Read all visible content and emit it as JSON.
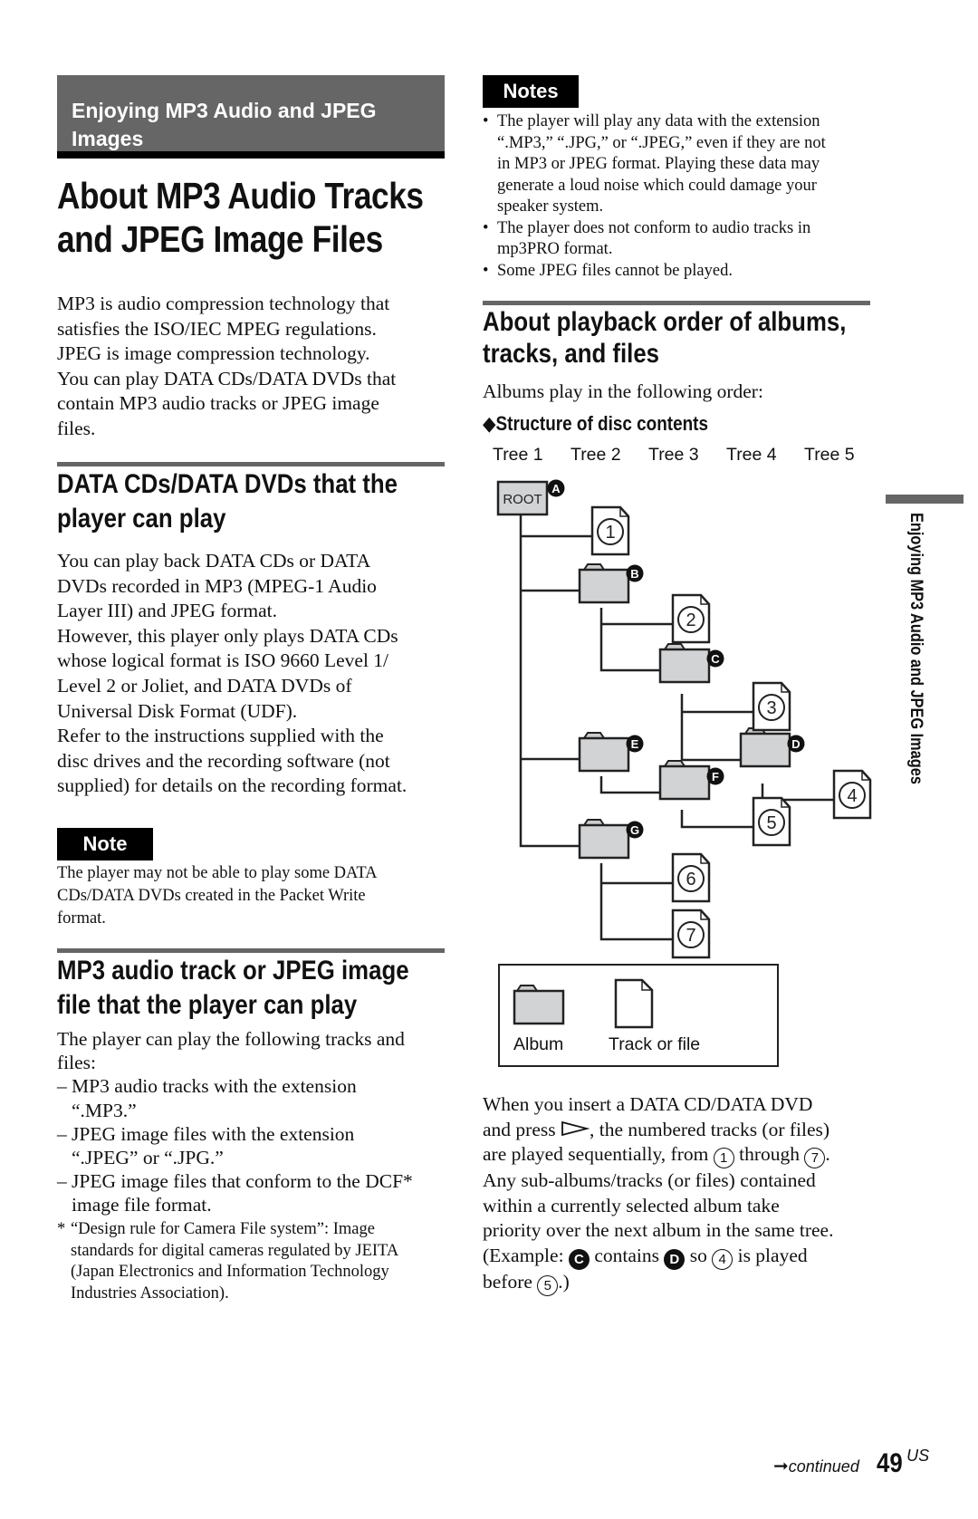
{
  "section_band": {
    "title": "Enjoying MP3 Audio and JPEG Images"
  },
  "main_title": {
    "line1": "About MP3 Audio Tracks",
    "line2": "and JPEG Image Files"
  },
  "intro": {
    "lines": [
      "MP3 is audio compression technology that",
      "satisfies the ISO/IEC MPEG regulations.",
      "JPEG is image compression technology.",
      "You can play DATA CDs/DATA DVDs that",
      "contain MP3 audio tracks or JPEG image",
      "files."
    ]
  },
  "section_discs": {
    "heading_line1": "DATA CDs/DATA DVDs that the",
    "heading_line2": "player can play",
    "lines": [
      "You can play back DATA CDs or DATA",
      "DVDs recorded in MP3 (MPEG-1 Audio",
      "Layer III) and JPEG format.",
      "However, this player only plays DATA CDs",
      "whose logical format is ISO 9660 Level 1/",
      "Level 2 or Joliet, and DATA DVDs of",
      "Universal Disk Format (UDF).",
      "Refer to the instructions supplied with the",
      "disc drives and the recording software (not",
      "supplied) for details on the recording format."
    ],
    "note_label": "Note",
    "note_lines": [
      "The player may not be able to play some DATA",
      "CDs/DATA DVDs created in the Packet Write",
      "format."
    ]
  },
  "section_files": {
    "heading_line1": "MP3 audio track or JPEG image",
    "heading_line2": "file that the player can play",
    "intro_line1": "The player can play the following tracks and",
    "intro_line2": "files:",
    "items": [
      {
        "line1": "MP3 audio tracks with the extension",
        "line2": "“.MP3.”"
      },
      {
        "line1": "JPEG image files with the extension",
        "line2": "“.JPEG” or “.JPG.”"
      },
      {
        "line1": "JPEG image files that conform to the DCF*",
        "line2": "image file format."
      }
    ],
    "footnote_star": "*",
    "footnote_lines": [
      "“Design rule for Camera File system”: Image",
      "standards for digital cameras regulated by JEITA",
      "(Japan Electronics and Information Technology",
      "Industries Association)."
    ]
  },
  "notes": {
    "label": "Notes",
    "items": [
      {
        "lines": [
          "The player will play any data with the extension",
          "“.MP3,” “.JPG,” or “.JPEG,” even if they are not",
          "in MP3 or JPEG format. Playing these data may",
          "generate a loud noise which could damage your",
          "speaker system."
        ]
      },
      {
        "lines": [
          "The player does not conform to audio tracks in",
          "mp3PRO format."
        ]
      },
      {
        "lines": [
          "Some JPEG files cannot be played."
        ]
      }
    ]
  },
  "section_order": {
    "heading_line1": "About playback order of albums,",
    "heading_line2": "tracks, and files",
    "intro": "Albums play in the following order:",
    "subhead_marker": "◆",
    "subhead": "Structure of disc contents"
  },
  "diagram": {
    "trees": [
      "Tree 1",
      "Tree 2",
      "Tree 3",
      "Tree 4",
      "Tree 5"
    ],
    "root_label": "ROOT",
    "album_letters": [
      "A",
      "B",
      "C",
      "D",
      "E",
      "F",
      "G"
    ],
    "track_numbers": [
      "1",
      "2",
      "3",
      "4",
      "5",
      "6",
      "7"
    ],
    "legend": {
      "album": "Album",
      "track": "Track or file"
    }
  },
  "explanation": {
    "l1": "When you insert a DATA CD/DATA DVD",
    "l2a": "and press ",
    "l2b": ", the numbered tracks (or files)",
    "l3a": "are played sequentially, from ",
    "l3n1": "1",
    "l3b": " through ",
    "l3n2": "7",
    "l3c": ".",
    "l4": "Any sub-albums/tracks (or files) contained",
    "l5": "within a currently selected album take",
    "l6": "priority over the next album in the same tree.",
    "l7a": "(Example: ",
    "l7c1": "C",
    "l7b": " contains ",
    "l7c2": "D",
    "l7c": " so ",
    "l7n": "4",
    "l7d": " is played",
    "l8a": "before ",
    "l8n": "5",
    "l8b": ".)"
  },
  "side_tab": {
    "text": "Enjoying MP3 Audio and JPEG Images"
  },
  "footer": {
    "arrow": "➞",
    "continued": "continued",
    "page": "49",
    "region": "US"
  }
}
